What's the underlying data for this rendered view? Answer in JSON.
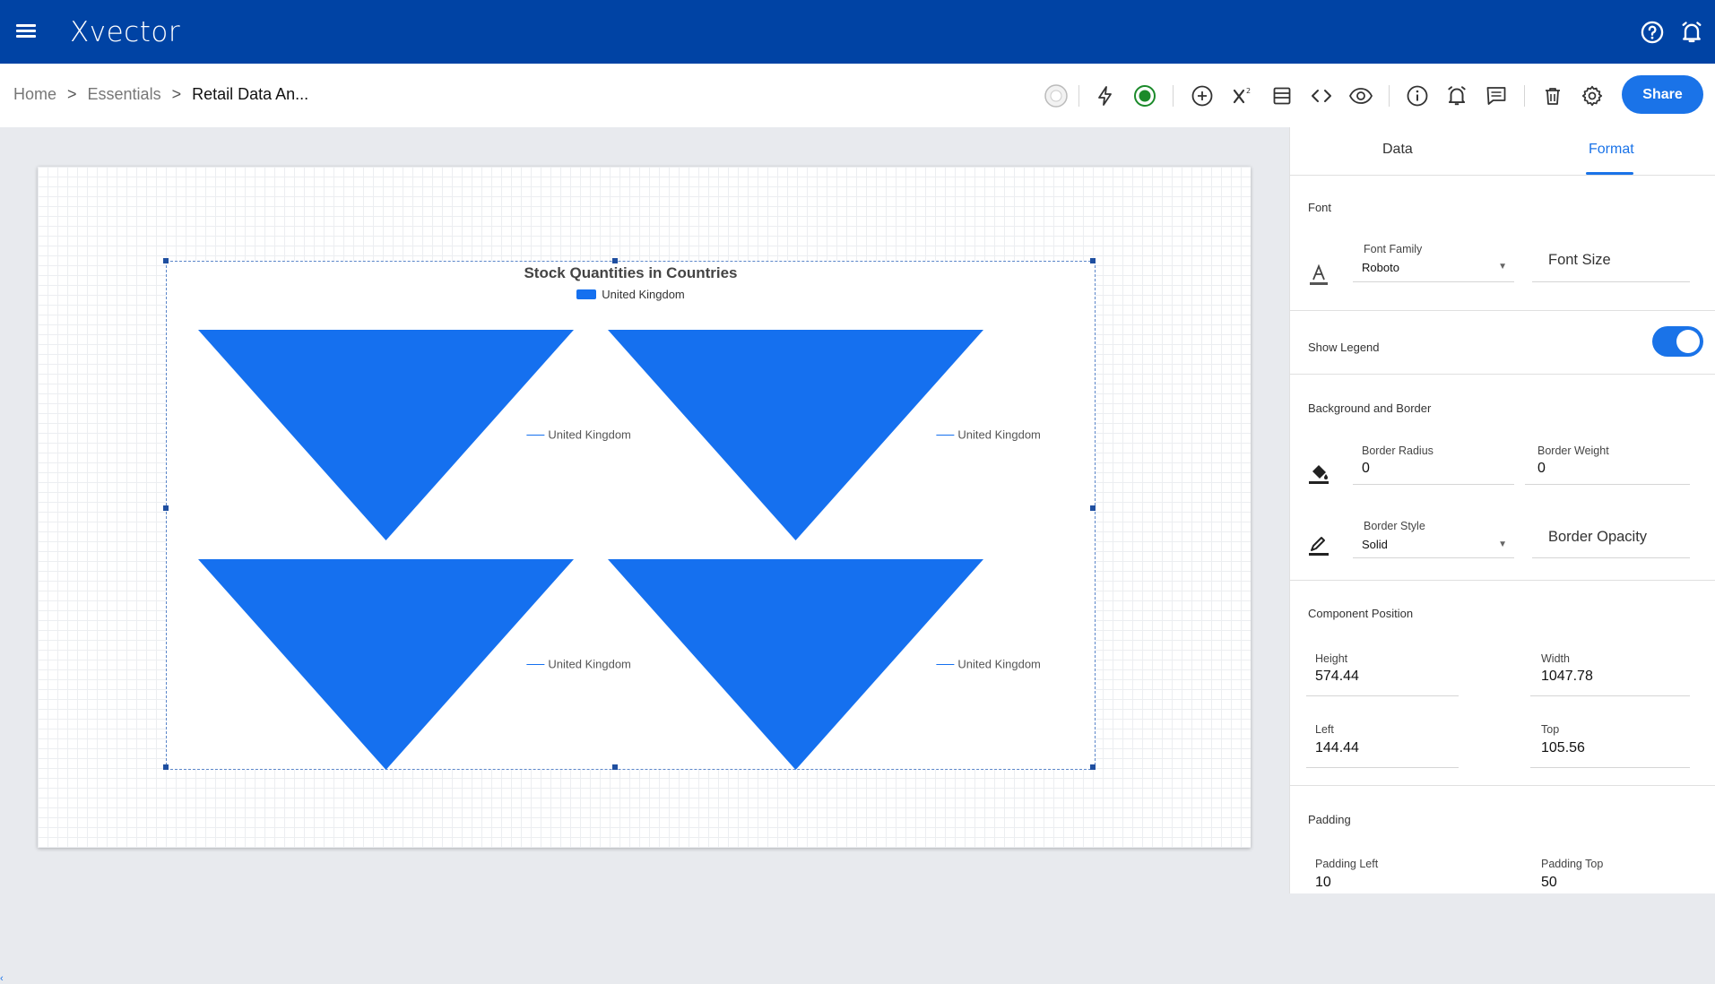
{
  "app": {
    "logo": "Xvector"
  },
  "breadcrumb": {
    "home": "Home",
    "sep": ">",
    "level1": "Essentials",
    "current": "Retail Data An..."
  },
  "toolbar": {
    "share_label": "Share"
  },
  "panel": {
    "tabs": [
      {
        "label": "Data"
      },
      {
        "label": "Format"
      }
    ],
    "font": {
      "section": "Font",
      "family_label": "Font Family",
      "family_value": "Roboto",
      "size_placeholder": "Font Size"
    },
    "legend": {
      "label": "Show Legend",
      "enabled": true
    },
    "background": {
      "section": "Background and Border",
      "radius_label": "Border Radius",
      "radius_value": "0",
      "weight_label": "Border Weight",
      "weight_value": "0",
      "style_label": "Border Style",
      "style_value": "Solid",
      "opacity_placeholder": "Border Opacity"
    },
    "position": {
      "section": "Component Position",
      "height_label": "Height",
      "height_value": "574.44",
      "width_label": "Width",
      "width_value": "1047.78",
      "left_label": "Left",
      "left_value": "144.44",
      "top_label": "Top",
      "top_value": "105.56"
    },
    "padding": {
      "section": "Padding",
      "left_label": "Padding Left",
      "left_value": "10",
      "top_label": "Padding Top",
      "top_value": "50"
    }
  },
  "colors": {
    "topbar": "#0043a4",
    "accent": "#1a73e8",
    "funnel": "#1570ef"
  },
  "chart_data": {
    "type": "funnel",
    "title": "Stock Quantities in Countries",
    "legend": [
      "United Kingdom"
    ],
    "panels": [
      {
        "label": "United Kingdom"
      },
      {
        "label": "United Kingdom"
      },
      {
        "label": "United Kingdom"
      },
      {
        "label": "United Kingdom"
      }
    ]
  }
}
